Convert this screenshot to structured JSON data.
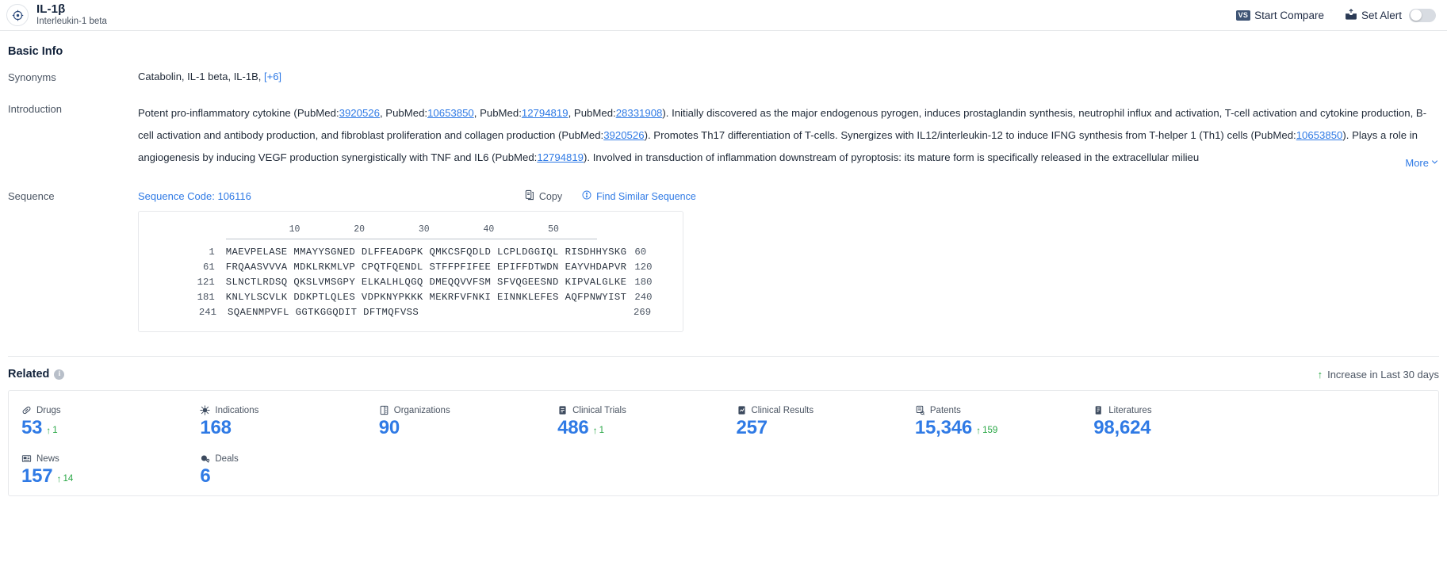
{
  "header": {
    "title": "IL-1β",
    "subtitle": "Interleukin-1 beta",
    "target_icon": "target-icon",
    "compare_badge": "VS",
    "compare_label": "Start Compare",
    "alert_label": "Set Alert",
    "alert_toggle_state": "off"
  },
  "basic_info": {
    "section_label": "Basic Info",
    "synonyms_label": "Synonyms",
    "synonyms_value": "Catabolin,  IL-1 beta,  IL-1B,",
    "synonyms_more": "[+6]",
    "introduction_label": "Introduction",
    "introduction_more": "More",
    "introduction_parts": [
      {
        "t": "Potent pro-inflammatory cytokine (PubMed:",
        "k": "text"
      },
      {
        "t": "3920526",
        "k": "link"
      },
      {
        "t": ", PubMed:",
        "k": "text"
      },
      {
        "t": "10653850",
        "k": "link"
      },
      {
        "t": ", PubMed:",
        "k": "text"
      },
      {
        "t": "12794819",
        "k": "link"
      },
      {
        "t": ", PubMed:",
        "k": "text"
      },
      {
        "t": "28331908",
        "k": "link"
      },
      {
        "t": "). Initially discovered as the major endogenous pyrogen, induces prostaglandin synthesis, neutrophil influx and activation, T-cell activation and cytokine production, B-cell activation and antibody production, and fibroblast proliferation and collagen production (PubMed:",
        "k": "text"
      },
      {
        "t": "3920526",
        "k": "link"
      },
      {
        "t": "). Promotes Th17 differentiation of T-cells. Synergizes with IL12/interleukin-12 to induce IFNG synthesis from T-helper 1 (Th1) cells (PubMed:",
        "k": "text"
      },
      {
        "t": "10653850",
        "k": "link"
      },
      {
        "t": "). Plays a role in angiogenesis by inducing VEGF production synergistically with TNF and IL6 (PubMed:",
        "k": "text"
      },
      {
        "t": "12794819",
        "k": "link"
      },
      {
        "t": "). Involved in transduction of inflammation downstream of pyroptosis: its mature form is specifically released in the extracellular milieu",
        "k": "text"
      }
    ]
  },
  "sequence": {
    "row_label": "Sequence",
    "code_label": "Sequence Code: 106116",
    "copy_label": "Copy",
    "find_similar_label": "Find Similar Sequence",
    "ruler_ticks": [
      "10",
      "20",
      "30",
      "40",
      "50"
    ],
    "lines": [
      {
        "start": "1",
        "aa": "MAEVPELASE MMAYYSGNED DLFFEADGPK QMKCSFQDLD LCPLDGGIQL RISDHHYSKG",
        "end": "60"
      },
      {
        "start": "61",
        "aa": "FRQAASVVVA MDKLRKMLVP CPQTFQENDL STFFPFIFEE EPIFFDTWDN EAYVHDAPVR",
        "end": "120"
      },
      {
        "start": "121",
        "aa": "SLNCTLRDSQ QKSLVMSGPY ELKALHLQGQ DMEQQVVFSM SFVQGEESND KIPVALGLKE",
        "end": "180"
      },
      {
        "start": "181",
        "aa": "KNLYLSCVLK DDKPTLQLES VDPKNYPKKK MEKRFVFNKI EINNKLEFES AQFPNWYIST",
        "end": "240"
      },
      {
        "start": "241",
        "aa": "SQAENMPVFL GGTKGGQDIT DFTMQFVSS",
        "end": "269"
      }
    ]
  },
  "related": {
    "title": "Related",
    "info_glyph": "i",
    "legend_arrow": "↑",
    "legend_label": "Increase in Last 30 days",
    "cards": [
      {
        "label": "Drugs",
        "icon": "pill-icon",
        "value": "53",
        "delta": "1"
      },
      {
        "label": "Indications",
        "icon": "virus-icon",
        "value": "168",
        "delta": ""
      },
      {
        "label": "Organizations",
        "icon": "building-icon",
        "value": "90",
        "delta": ""
      },
      {
        "label": "Clinical Trials",
        "icon": "clipboard-icon",
        "value": "486",
        "delta": "1"
      },
      {
        "label": "Clinical Results",
        "icon": "results-icon",
        "value": "257",
        "delta": ""
      },
      {
        "label": "Patents",
        "icon": "patent-icon",
        "value": "15,346",
        "delta": "159"
      },
      {
        "label": "Literatures",
        "icon": "book-icon",
        "value": "98,624",
        "delta": ""
      },
      {
        "label": "",
        "icon": "",
        "value": "",
        "delta": ""
      },
      {
        "label": "News",
        "icon": "news-icon",
        "value": "157",
        "delta": "14"
      },
      {
        "label": "Deals",
        "icon": "deal-icon",
        "value": "6",
        "delta": ""
      }
    ]
  }
}
